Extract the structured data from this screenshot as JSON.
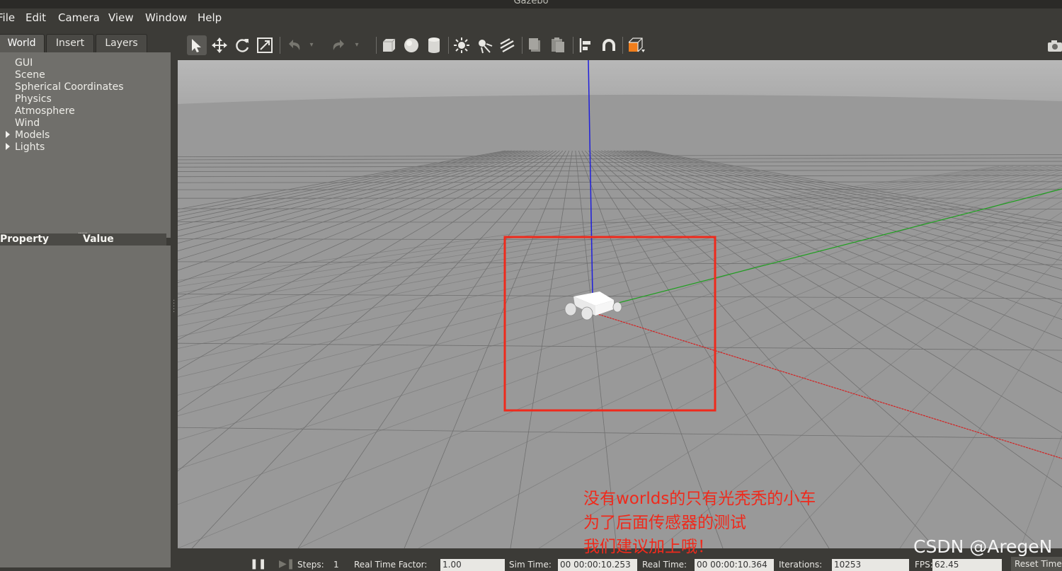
{
  "window": {
    "title": "Gazebo"
  },
  "menu": [
    "File",
    "Edit",
    "Camera",
    "View",
    "Window",
    "Help"
  ],
  "tabs": [
    "World",
    "Insert",
    "Layers"
  ],
  "world_tree": {
    "items": [
      "GUI",
      "Scene",
      "Spherical Coordinates",
      "Physics",
      "Atmosphere",
      "Wind",
      "Models",
      "Lights"
    ]
  },
  "properties": {
    "col_property": "Property",
    "col_value": "Value"
  },
  "toolbar": {
    "icons": [
      "select-arrow-icon",
      "translate-icon",
      "rotate-icon",
      "scale-icon",
      "undo-icon",
      "redo-icon",
      "box-icon",
      "sphere-icon",
      "cylinder-icon",
      "point-light-icon",
      "spot-light-icon",
      "directional-light-icon",
      "copy-icon",
      "paste-icon",
      "align-icon",
      "snap-icon",
      "change-view-icon",
      "screenshot-icon"
    ]
  },
  "status": {
    "steps_label": "Steps:",
    "steps_value": "1",
    "rtf_label": "Real Time Factor:",
    "rtf_value": "1.00",
    "sim_label": "Sim Time:",
    "sim_value": "00 00:00:10.253",
    "real_label": "Real Time:",
    "real_value": "00 00:00:10.364",
    "iter_label": "Iterations:",
    "iter_value": "10253",
    "fps_label": "FPS:",
    "fps_value": "62.45",
    "reset_label": "Reset Time"
  },
  "annotation": {
    "line1": "没有worlds的只有光秃秃的小车",
    "line2": "为了后面传感器的测试",
    "line3": "我们建议加上哦！",
    "color": "#ef2a1c"
  },
  "watermark": "CSDN @AregeN",
  "colors": {
    "viewport_bg": "#999999",
    "grid": "#6f6f6f",
    "axis_x": "#d32222",
    "axis_y": "#22a022",
    "axis_z": "#2020e0"
  }
}
